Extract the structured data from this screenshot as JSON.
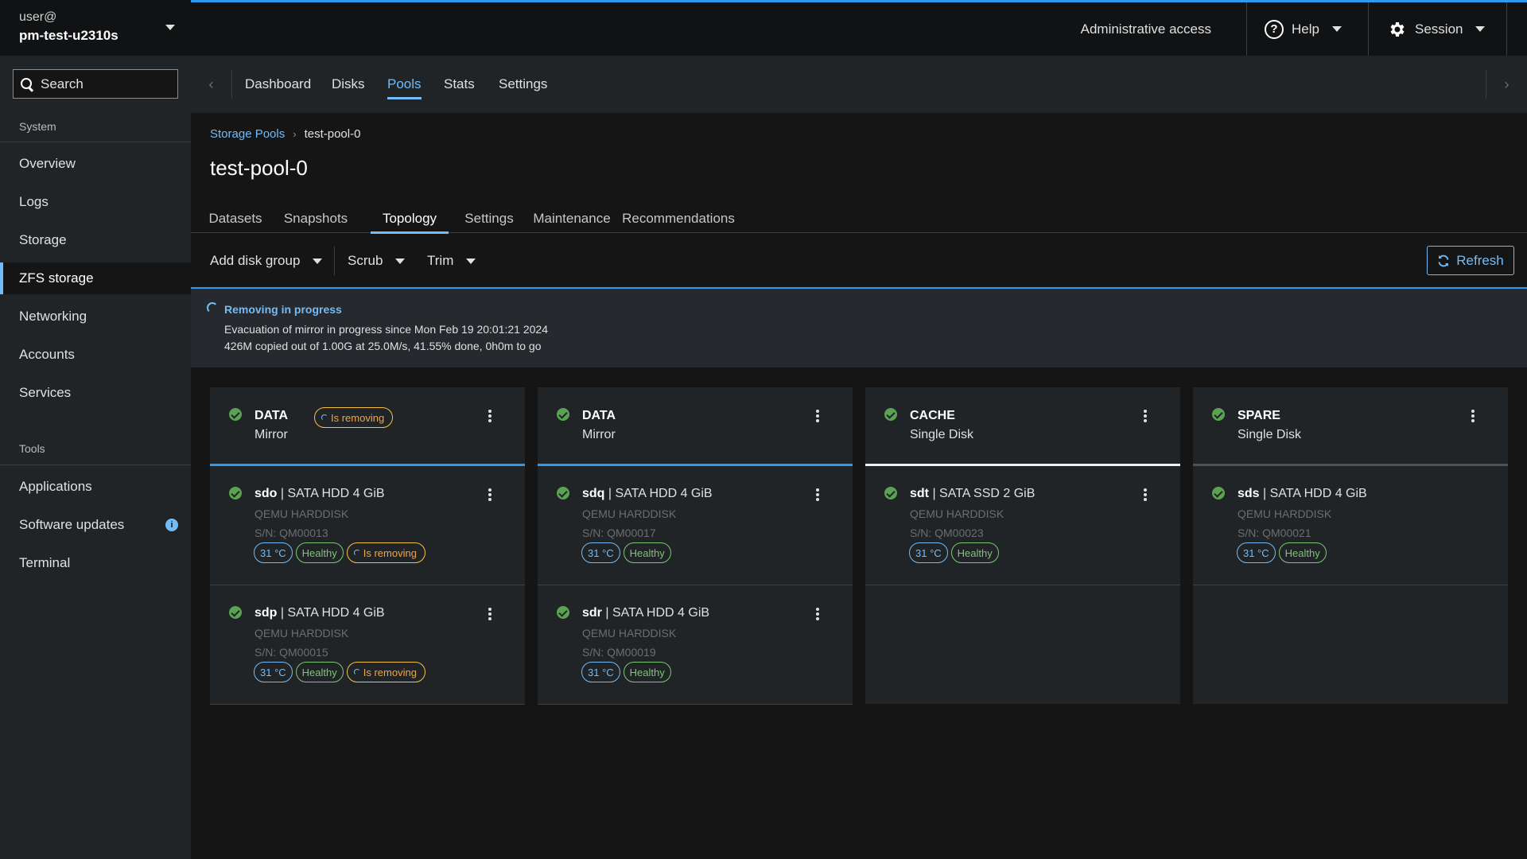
{
  "host": {
    "user": "user@",
    "name": "pm-test-u2310s"
  },
  "search": {
    "placeholder": "Search"
  },
  "nav": {
    "system_title": "System",
    "system_items": [
      "Overview",
      "Logs",
      "Storage",
      "ZFS storage",
      "Networking",
      "Accounts",
      "Services"
    ],
    "active_item": "ZFS storage",
    "tools_title": "Tools",
    "tools_items": [
      "Applications",
      "Software updates",
      "Terminal"
    ],
    "updates_badge": "i"
  },
  "masthead": {
    "admin": "Administrative access",
    "help": "Help",
    "session": "Session"
  },
  "page_tabs": {
    "items": [
      "Dashboard",
      "Disks",
      "Pools",
      "Stats",
      "Settings"
    ],
    "active": "Pools",
    "prev": "‹",
    "next": "›"
  },
  "breadcrumb": {
    "parent": "Storage Pools",
    "separator": "›",
    "current": "test-pool-0"
  },
  "title": "test-pool-0",
  "sub_tabs": {
    "items": [
      "Datasets",
      "Snapshots",
      "Topology",
      "Settings",
      "Maintenance",
      "Recommendations"
    ],
    "active": "Topology"
  },
  "toolbar": {
    "add_disk_group": "Add disk group",
    "scrub": "Scrub",
    "trim": "Trim",
    "refresh": "Refresh"
  },
  "alert": {
    "title": "Removing in progress",
    "line1": "Evacuation of mirror in progress since Mon Feb 19 20:01:21 2024",
    "line2": "426M copied out of 1.00G at 25.0M/s, 41.55% done, 0h0m to go"
  },
  "groups": [
    {
      "type": "DATA",
      "layout": "Mirror",
      "removing_badge": "Is removing",
      "disks": [
        {
          "name": "sdo",
          "desc": " | SATA HDD 4 GiB",
          "model": "QEMU HARDDISK",
          "serial": "S/N: QM00013",
          "temp": "31 °C",
          "health": "Healthy",
          "removing": "Is removing"
        },
        {
          "name": "sdp",
          "desc": " | SATA HDD 4 GiB",
          "model": "QEMU HARDDISK",
          "serial": "S/N: QM00015",
          "temp": "31 °C",
          "health": "Healthy",
          "removing": "Is removing"
        }
      ]
    },
    {
      "type": "DATA",
      "layout": "Mirror",
      "disks": [
        {
          "name": "sdq",
          "desc": " | SATA HDD 4 GiB",
          "model": "QEMU HARDDISK",
          "serial": "S/N: QM00017",
          "temp": "31 °C",
          "health": "Healthy"
        },
        {
          "name": "sdr",
          "desc": " | SATA HDD 4 GiB",
          "model": "QEMU HARDDISK",
          "serial": "S/N: QM00019",
          "temp": "31 °C",
          "health": "Healthy"
        }
      ]
    },
    {
      "type": "CACHE",
      "layout": "Single Disk",
      "disks": [
        {
          "name": "sdt",
          "desc": " | SATA SSD 2 GiB",
          "model": "QEMU HARDDISK",
          "serial": "S/N: QM00023",
          "temp": "31 °C",
          "health": "Healthy"
        }
      ]
    },
    {
      "type": "SPARE",
      "layout": "Single Disk",
      "disks": [
        {
          "name": "sds",
          "desc": " | SATA HDD 4 GiB",
          "model": "QEMU HARDDISK",
          "serial": "S/N: QM00021",
          "temp": "31 °C",
          "health": "Healthy"
        }
      ]
    }
  ],
  "colors": {
    "accent": "#73bcf7",
    "success": "#5ba352",
    "warning": "#f4c145",
    "progress": "#2b9af3"
  }
}
